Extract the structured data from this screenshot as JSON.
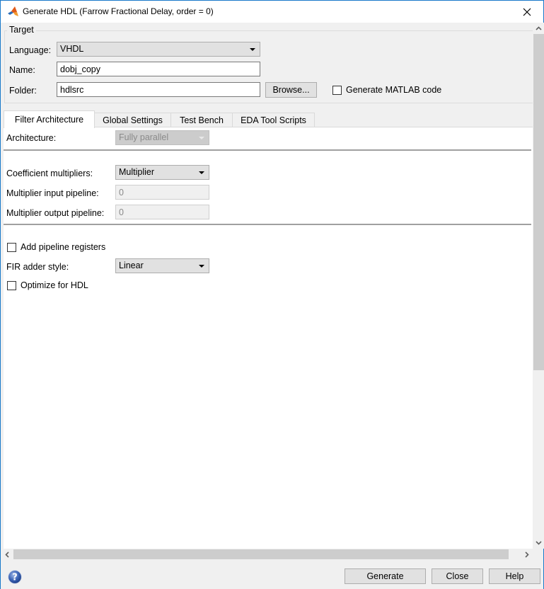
{
  "window": {
    "title": "Generate HDL (Farrow Fractional Delay, order = 0)",
    "icon": "matlab-logo-icon",
    "close_icon": "close-icon",
    "accent_color": "#1979ca"
  },
  "target": {
    "group_label": "Target",
    "language_label": "Language:",
    "language_value": "VHDL",
    "name_label": "Name:",
    "name_value": "dobj_copy",
    "folder_label": "Folder:",
    "folder_value": "hdlsrc",
    "browse_label": "Browse...",
    "generate_matlab_label": "Generate MATLAB code",
    "generate_matlab_checked": false
  },
  "tabs": [
    {
      "label": "Filter Architecture",
      "active": true
    },
    {
      "label": "Global Settings",
      "active": false
    },
    {
      "label": "Test Bench",
      "active": false
    },
    {
      "label": "EDA Tool Scripts",
      "active": false
    }
  ],
  "filter_architecture": {
    "architecture_label": "Architecture:",
    "architecture_value": "Fully parallel",
    "architecture_enabled": false,
    "coeff_mult_label": "Coefficient multipliers:",
    "coeff_mult_value": "Multiplier",
    "mult_input_pipeline_label": "Multiplier input pipeline:",
    "mult_input_pipeline_value": "0",
    "mult_output_pipeline_label": "Multiplier output pipeline:",
    "mult_output_pipeline_value": "0",
    "add_pipeline_label": "Add pipeline registers",
    "add_pipeline_checked": false,
    "fir_adder_label": "FIR adder style:",
    "fir_adder_value": "Linear",
    "optimize_hdl_label": "Optimize for HDL",
    "optimize_hdl_checked": false
  },
  "footer": {
    "help_icon": "help-question-icon",
    "generate_label": "Generate",
    "close_label": "Close",
    "help_label": "Help"
  }
}
